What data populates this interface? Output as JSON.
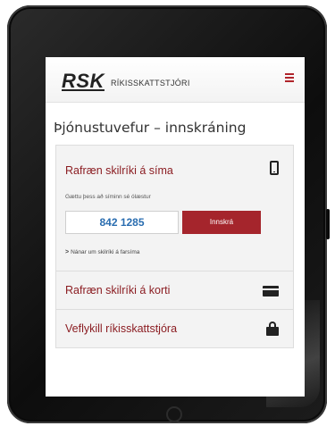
{
  "header": {
    "logo": "RSK",
    "logo_subtitle": "RÍKISSKATTSTJÓRI",
    "menu_icon": "hamburger-icon",
    "accent": "#b0252c"
  },
  "page": {
    "title": "Þjónustuvefur – innskráning"
  },
  "options": {
    "phone": {
      "label": "Rafræn skilríki á síma",
      "icon": "phone-icon",
      "hint": "Gættu þess að síminn sé ólæstur",
      "input_value": "842 1285",
      "login_label": "Innskrá",
      "more_link_marker": ">",
      "more_link": "Nánar um skilríki á farsíma"
    },
    "card": {
      "label": "Rafræn skilríki á korti",
      "icon": "card-icon"
    },
    "key": {
      "label": "Veflykill ríkisskattstjóra",
      "icon": "lock-icon"
    }
  }
}
